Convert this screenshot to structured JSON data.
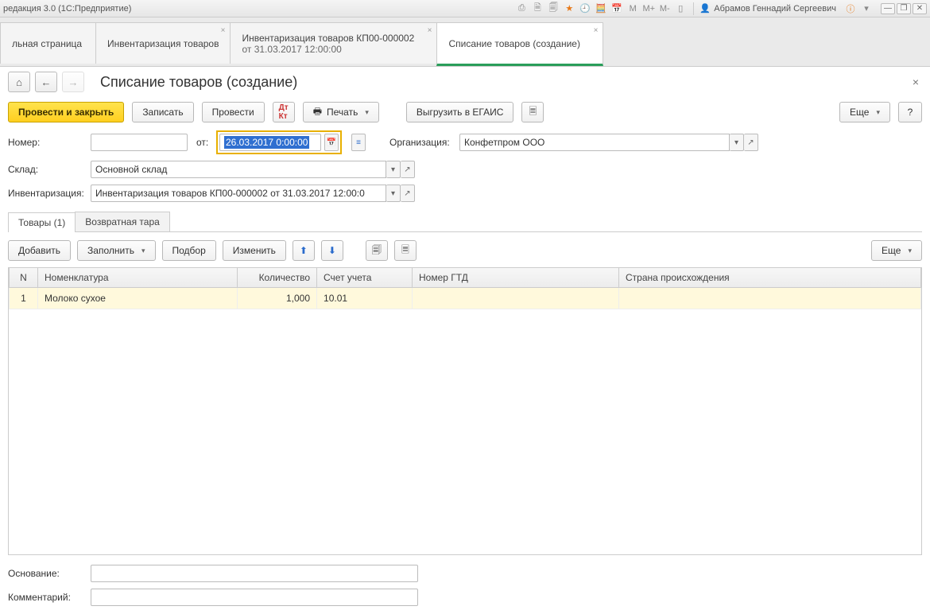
{
  "titlebar": {
    "text": "редакция 3.0  (1С:Предприятие)",
    "user": "Абрамов Геннадий Сергеевич"
  },
  "tabs": [
    {
      "label": "льная страница"
    },
    {
      "label": "Инвентаризация товаров"
    },
    {
      "label": "Инвентаризация товаров КП00-000002",
      "sub": "от 31.03.2017 12:00:00"
    },
    {
      "label": "Списание товаров (создание)",
      "active": true
    }
  ],
  "page": {
    "title": "Списание товаров (создание)"
  },
  "toolbar": {
    "post_close": "Провести и закрыть",
    "save": "Записать",
    "post": "Провести",
    "print": "Печать",
    "egais": "Выгрузить в ЕГАИС",
    "more": "Еще",
    "help": "?"
  },
  "fields": {
    "number_label": "Номер:",
    "number_value": "",
    "ot": "от:",
    "date_value": "26.03.2017  0:00:00",
    "org_label": "Организация:",
    "org_value": "Конфетпром ООО",
    "sklad_label": "Склад:",
    "sklad_value": "Основной склад",
    "inv_label": "Инвентаризация:",
    "inv_value": "Инвентаризация товаров КП00-000002 от 31.03.2017 12:00:0",
    "osnov_label": "Основание:",
    "osnov_value": "",
    "comment_label": "Комментарий:",
    "comment_value": ""
  },
  "subtabs": {
    "goods": "Товары (1)",
    "tara": "Возвратная тара"
  },
  "row_toolbar": {
    "add": "Добавить",
    "fill": "Заполнить",
    "pick": "Подбор",
    "change": "Изменить",
    "more": "Еще"
  },
  "table": {
    "headers": {
      "n": "N",
      "nomen": "Номенклатура",
      "qty": "Количество",
      "acct": "Счет учета",
      "gtd": "Номер ГТД",
      "country": "Страна происхождения"
    },
    "rows": [
      {
        "n": "1",
        "nomen": "Молоко сухое",
        "qty": "1,000",
        "acct": "10.01",
        "gtd": "",
        "country": ""
      }
    ]
  }
}
